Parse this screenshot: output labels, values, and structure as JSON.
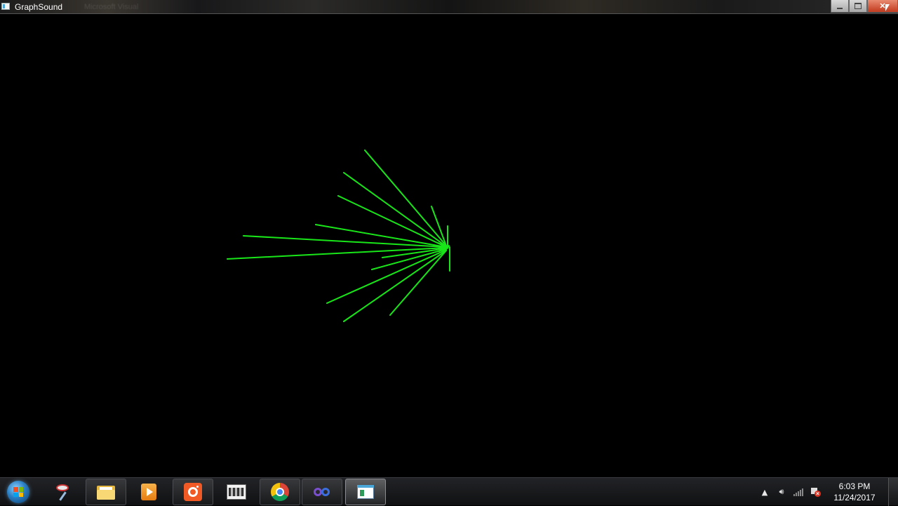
{
  "window": {
    "title": "GraphSound",
    "background_title": "Microsoft Visual"
  },
  "graph": {
    "line_color": "#19e619",
    "background": "#000000"
  },
  "taskbar": {
    "items": [
      {
        "name": "start",
        "icon": "windows-orb-icon"
      },
      {
        "name": "snipping-tool",
        "icon": "scissors-icon"
      },
      {
        "name": "file-explorer",
        "icon": "folder-icon"
      },
      {
        "name": "media-player",
        "icon": "media-player-icon"
      },
      {
        "name": "screen-recorder",
        "icon": "record-icon"
      },
      {
        "name": "movie-maker",
        "icon": "film-icon"
      },
      {
        "name": "chrome",
        "icon": "chrome-icon"
      },
      {
        "name": "visual-studio",
        "icon": "visual-studio-icon"
      },
      {
        "name": "graphsound-app",
        "icon": "app-window-icon"
      }
    ],
    "tray": {
      "clock_time": "6:03 PM",
      "clock_date": "11/24/2017"
    }
  }
}
